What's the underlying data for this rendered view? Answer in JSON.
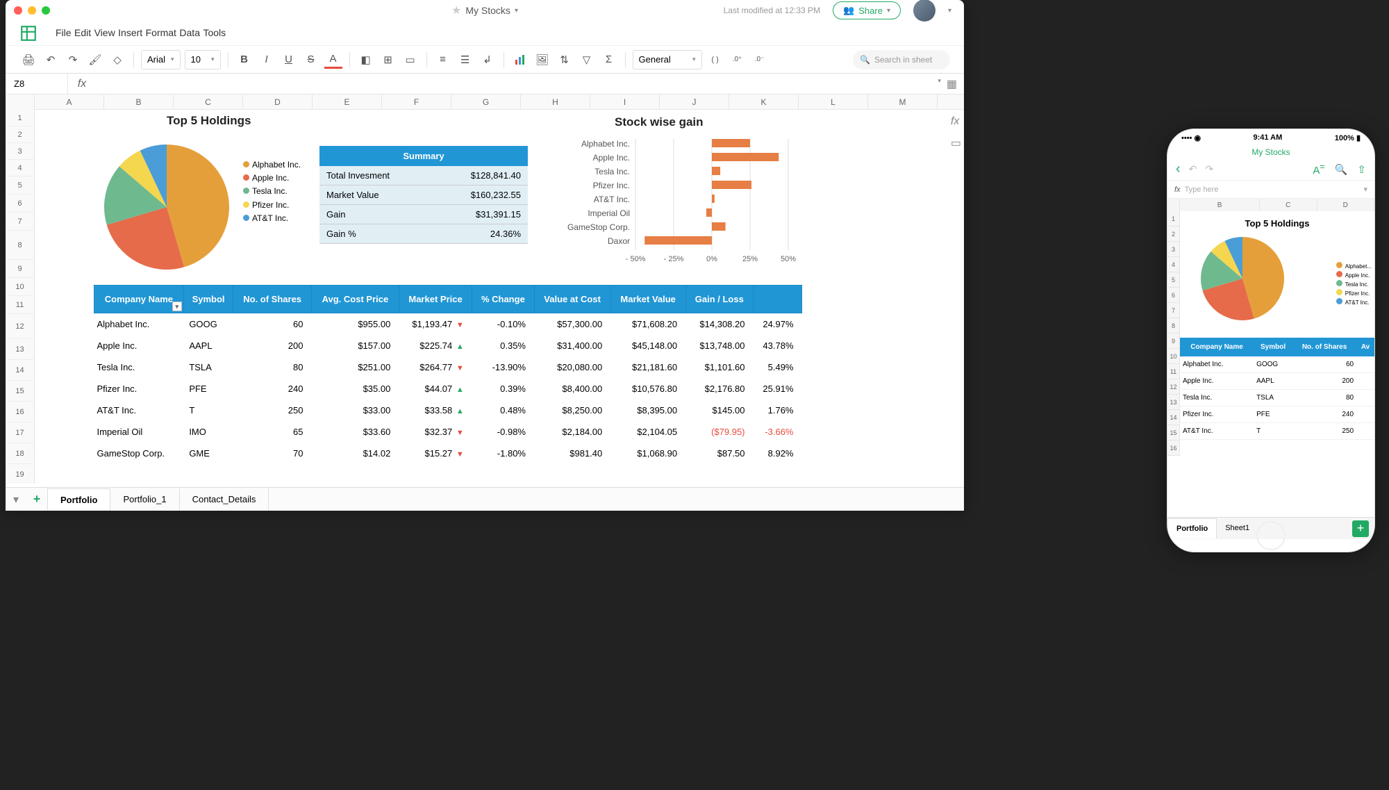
{
  "doc_title": "My Stocks",
  "modified": "Last modified at 12:33 PM",
  "share_label": "Share",
  "menu": [
    "File",
    "Edit",
    "View",
    "Insert",
    "Format",
    "Data",
    "Tools"
  ],
  "font": "Arial",
  "font_size": "10",
  "cell_ref": "Z8",
  "number_format": "General",
  "search_ph": "Search in sheet",
  "columns": [
    "A",
    "B",
    "C",
    "D",
    "E",
    "F",
    "G",
    "H",
    "I",
    "J",
    "K",
    "L",
    "M"
  ],
  "row_numbers": [
    1,
    2,
    3,
    4,
    5,
    6,
    7,
    8,
    9,
    10,
    11,
    12,
    13,
    14,
    15,
    16,
    17,
    18,
    19
  ],
  "titles": {
    "holdings": "Top 5 Holdings",
    "stockgain": "Stock wise gain",
    "summary_header": "Summary"
  },
  "summary": [
    [
      "Total Invesment",
      "$128,841.40"
    ],
    [
      "Market Value",
      "$160,232.55"
    ],
    [
      "Gain",
      "$31,391.15"
    ],
    [
      "Gain %",
      "24.36%"
    ]
  ],
  "table_headers": [
    "Company Name",
    "Symbol",
    "No. of Shares",
    "Avg. Cost Price",
    "Market Price",
    "% Change",
    "Value at Cost",
    "Market Value",
    "Gain / Loss",
    ""
  ],
  "table_rows": [
    {
      "company": "Alphabet Inc.",
      "symbol": "GOOG",
      "shares": "60",
      "avgcost": "$955.00",
      "mprice": "$1,193.47",
      "dir": "dn",
      "pctchange": "-0.10%",
      "valcost": "$57,300.00",
      "mval": "$71,608.20",
      "gain": "$14,308.20",
      "gainpct": "24.97%"
    },
    {
      "company": "Apple Inc.",
      "symbol": "AAPL",
      "shares": "200",
      "avgcost": "$157.00",
      "mprice": "$225.74",
      "dir": "up",
      "pctchange": "0.35%",
      "valcost": "$31,400.00",
      "mval": "$45,148.00",
      "gain": "$13,748.00",
      "gainpct": "43.78%"
    },
    {
      "company": "Tesla Inc.",
      "symbol": "TSLA",
      "shares": "80",
      "avgcost": "$251.00",
      "mprice": "$264.77",
      "dir": "dn",
      "pctchange": "-13.90%",
      "valcost": "$20,080.00",
      "mval": "$21,181.60",
      "gain": "$1,101.60",
      "gainpct": "5.49%"
    },
    {
      "company": "Pfizer Inc.",
      "symbol": "PFE",
      "shares": "240",
      "avgcost": "$35.00",
      "mprice": "$44.07",
      "dir": "up",
      "pctchange": "0.39%",
      "valcost": "$8,400.00",
      "mval": "$10,576.80",
      "gain": "$2,176.80",
      "gainpct": "25.91%"
    },
    {
      "company": "AT&T Inc.",
      "symbol": "T",
      "shares": "250",
      "avgcost": "$33.00",
      "mprice": "$33.58",
      "dir": "up",
      "pctchange": "0.48%",
      "valcost": "$8,250.00",
      "mval": "$8,395.00",
      "gain": "$145.00",
      "gainpct": "1.76%"
    },
    {
      "company": "Imperial Oil",
      "symbol": "IMO",
      "shares": "65",
      "avgcost": "$33.60",
      "mprice": "$32.37",
      "dir": "dn",
      "pctchange": "-0.98%",
      "valcost": "$2,184.00",
      "mval": "$2,104.05",
      "gain": "($79.95)",
      "gainpct": "-3.66%",
      "neg": true
    },
    {
      "company": "GameStop Corp.",
      "symbol": "GME",
      "shares": "70",
      "avgcost": "$14.02",
      "mprice": "$15.27",
      "dir": "dn",
      "pctchange": "-1.80%",
      "valcost": "$981.40",
      "mval": "$1,068.90",
      "gain": "$87.50",
      "gainpct": "8.92%"
    }
  ],
  "sheets": [
    "Portfolio",
    "Portfolio_1",
    "Contact_Details"
  ],
  "chart_data": [
    {
      "type": "pie",
      "title": "Top 5 Holdings",
      "series": [
        {
          "name": "Alphabet Inc.",
          "value": 45.5,
          "color": "#e59f3a"
        },
        {
          "name": "Apple Inc.",
          "value": 24.9,
          "color": "#e66b4a"
        },
        {
          "name": "Tesla Inc.",
          "value": 15.9,
          "color": "#6fb98f"
        },
        {
          "name": "Pfizer Inc.",
          "value": 6.7,
          "color": "#f4d64f"
        },
        {
          "name": "AT&T Inc.",
          "value": 7.0,
          "color": "#4a9dd6"
        }
      ]
    },
    {
      "type": "bar",
      "title": "Stock wise gain",
      "orientation": "horizontal",
      "xlabel": "",
      "ylabel": "",
      "xlim": [
        -50,
        50
      ],
      "xticks": [
        "- 50%",
        "- 25%",
        "0%",
        "25%",
        "50%"
      ],
      "categories": [
        "Alphabet Inc.",
        "Apple Inc.",
        "Tesla Inc.",
        "Pfizer Inc.",
        "AT&T Inc.",
        "Imperial Oil",
        "GameStop Corp.",
        "Daxor"
      ],
      "values": [
        24.97,
        43.78,
        5.49,
        25.91,
        1.76,
        -3.66,
        8.92,
        -44
      ],
      "color": "#e67e45"
    }
  ],
  "phone": {
    "time": "9:41 AM",
    "battery": "100%",
    "title": "My Stocks",
    "type_ph": "Type here",
    "cols": [
      "B",
      "C",
      "D"
    ],
    "rows": [
      1,
      2,
      3,
      4,
      5,
      6,
      7,
      8,
      9,
      10,
      11,
      12,
      13,
      14,
      15,
      16
    ],
    "pie_title": "Top 5 Holdings",
    "legend": [
      "Alphabet...",
      "Apple Inc.",
      "Tesla Inc.",
      "Pfizer Inc.",
      "AT&T Inc."
    ],
    "th": [
      "Company Name",
      "Symbol",
      "No. of Shares",
      "Av"
    ],
    "rows_data": [
      [
        "Alphabet Inc.",
        "GOOG",
        "60"
      ],
      [
        "Apple Inc.",
        "AAPL",
        "200"
      ],
      [
        "Tesla Inc.",
        "TSLA",
        "80"
      ],
      [
        "Pfizer Inc.",
        "PFE",
        "240"
      ],
      [
        "AT&T Inc.",
        "T",
        "250"
      ]
    ],
    "tabs": [
      "Portfolio",
      "Sheet1"
    ]
  }
}
